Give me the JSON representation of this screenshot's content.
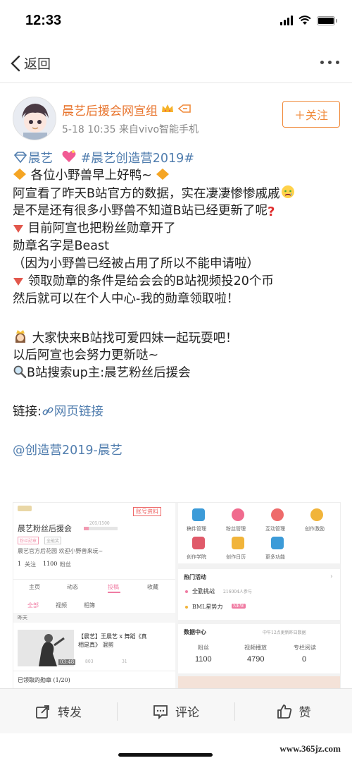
{
  "status_bar": {
    "time": "12:33"
  },
  "nav": {
    "back_label": "返回"
  },
  "post": {
    "author": "晨艺后援会网宣组",
    "meta": "5-18 10:35  来自vivo智能手机",
    "follow_label": "＋关注",
    "lines": {
      "l1_a": "晨艺",
      "l1_b": "#晨艺创造营2019#",
      "l2": "各位小野兽早上好鸭~",
      "l3": "阿宣看了昨天B站官方的数据，实在凄凄惨惨戚戚",
      "l4": "是不是还有很多小野兽不知道B站已经更新了呢",
      "l5": "目前阿宣也把粉丝勋章开了",
      "l6": "勋章名字是Beast",
      "l7": "（因为小野兽已经被占用了所以不能申请啦）",
      "l8": "领取勋章的条件是给会会的B站视频投20个币",
      "l9": "然后就可以在个人中心-我的勋章领取啦！",
      "l10": "大家快来B站找可爱四妹一起玩耍吧！",
      "l11": "以后阿宣也会努力更新哒~",
      "l12": "B站搜索up主:晨艺粉丝后援会",
      "link_prefix": "链接:",
      "link_text": "网页链接",
      "mention": "@创造营2019-晨艺"
    }
  },
  "embedded": {
    "left": {
      "profile_tag": "账号资料",
      "name": "晨艺粉丝后援会",
      "level": "205/1500",
      "tag1": "粉丝勋章",
      "tag2": "全能奖",
      "desc": "晨艺官方后花园 欢迎小野兽来玩~",
      "follow_count": "1",
      "follow_label": "关注",
      "fans_count": "1100",
      "fans_label": "粉丝",
      "tabs": [
        "主页",
        "动态",
        "投稿",
        "收藏"
      ],
      "subtabs": [
        "全部",
        "视频",
        "相簿"
      ],
      "section": "昨天",
      "video_title_1": "【晨艺】王晨艺 x 舞蹈《真",
      "video_title_2": "相是真》 混剪",
      "video_duration": "03:48",
      "video_views": "803",
      "video_danmaku": "31",
      "medal_label": "已领取的勋章 (1/20)"
    },
    "right": {
      "grid": [
        "稿件管理",
        "粉丝管理",
        "互动管理",
        "创作激励",
        "创作学院",
        "创作日历",
        "更多功能"
      ],
      "hot_title": "热门活动",
      "hot1": "全勤挑战",
      "hot1_sub": "216004人参与",
      "hot2": "BML星势力",
      "hot2_badge": "NEW",
      "data_title": "数据中心",
      "data_note": "中午12点更新昨日数据",
      "stats_labels": [
        "粉丝",
        "视频播放",
        "专栏阅读"
      ],
      "stats_values": [
        "1100",
        "4790",
        "0"
      ]
    }
  },
  "actions": {
    "repost": "转发",
    "comment": "评论",
    "like": "赞"
  },
  "watermark": "www.365jz.com",
  "colors": {
    "accent": "#f08a3a",
    "link": "#507dae",
    "author": "#e8742d"
  }
}
